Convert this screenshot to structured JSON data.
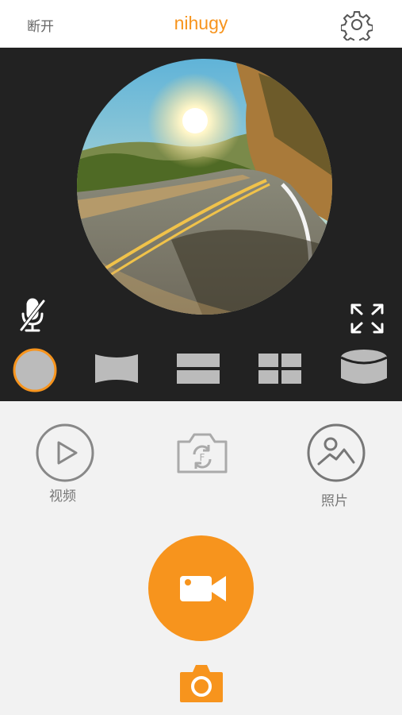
{
  "header": {
    "disconnect_label": "断开",
    "app_title": "nihugy",
    "accent_color": "#f7941d"
  },
  "preview": {
    "mic_state": "muted",
    "view_modes": [
      "circle",
      "panorama",
      "split-2",
      "split-4",
      "cylinder"
    ],
    "selected_mode": "circle"
  },
  "controls": {
    "video_label": "视频",
    "photo_label": "照片"
  },
  "icons": [
    "gear-icon",
    "mic-muted-icon",
    "expand-icon",
    "play-icon",
    "camera-rotate-icon",
    "gallery-icon",
    "video-camera-icon",
    "camera-icon"
  ]
}
